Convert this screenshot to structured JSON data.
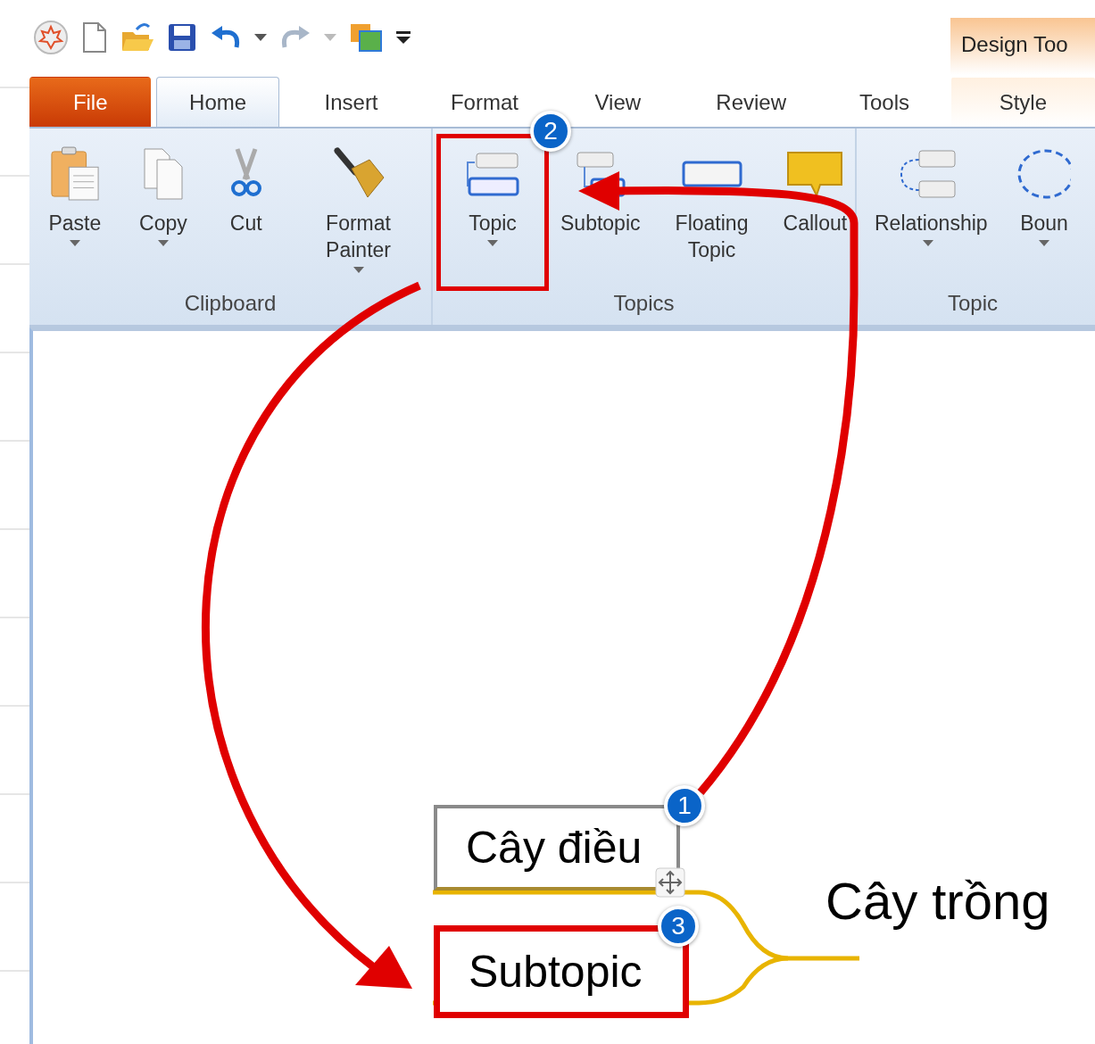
{
  "contextual_tab_group": {
    "title": "Design Too"
  },
  "tabs": [
    {
      "label": "File",
      "kind": "file",
      "selected": false
    },
    {
      "label": "Home",
      "kind": "normal",
      "selected": true
    },
    {
      "label": "Insert",
      "kind": "normal",
      "selected": false
    },
    {
      "label": "Format",
      "kind": "normal",
      "selected": false
    },
    {
      "label": "View",
      "kind": "normal",
      "selected": false
    },
    {
      "label": "Review",
      "kind": "normal",
      "selected": false
    },
    {
      "label": "Tools",
      "kind": "normal",
      "selected": false
    },
    {
      "label": "Style",
      "kind": "contextual",
      "selected": false
    }
  ],
  "ribbon_groups": [
    {
      "label": "Clipboard",
      "buttons": [
        {
          "label": "Paste",
          "kind": "paste",
          "dropdown": true,
          "highlighted": false
        },
        {
          "label": "Copy",
          "kind": "copy",
          "dropdown": true,
          "highlighted": false
        },
        {
          "label": "Cut",
          "kind": "cut",
          "dropdown": false,
          "highlighted": false
        },
        {
          "label": "Format Painter",
          "kind": "painter",
          "dropdown": true,
          "highlighted": false
        }
      ]
    },
    {
      "label": "Topics",
      "buttons": [
        {
          "label": "Topic",
          "kind": "topic",
          "dropdown": true,
          "highlighted": true
        },
        {
          "label": "Subtopic",
          "kind": "subtopic",
          "dropdown": false,
          "highlighted": false
        },
        {
          "label": "Floating Topic",
          "kind": "floating",
          "dropdown": false,
          "highlighted": false
        },
        {
          "label": "Callout",
          "kind": "callout",
          "dropdown": false,
          "highlighted": false
        }
      ]
    },
    {
      "label": "Topic",
      "buttons": [
        {
          "label": "Relationship",
          "kind": "relationship",
          "dropdown": true,
          "highlighted": false
        },
        {
          "label": "Boun",
          "kind": "boundary",
          "dropdown": true,
          "highlighted": false
        }
      ]
    }
  ],
  "step_badges": [
    "1",
    "2",
    "3"
  ],
  "mind_map": {
    "central_topic": "Cây trồng",
    "subtopics": [
      {
        "label": "Cây điều",
        "selected": true,
        "highlighted": false
      },
      {
        "label": "Subtopic",
        "selected": false,
        "highlighted": true
      }
    ]
  }
}
